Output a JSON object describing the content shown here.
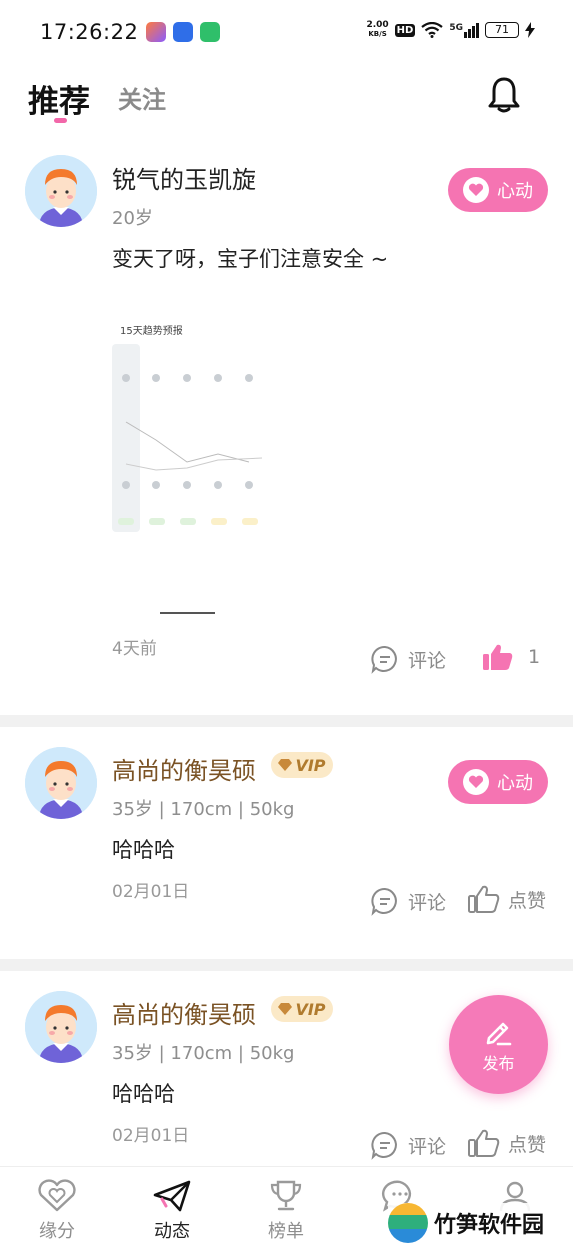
{
  "status_bar": {
    "time": "17:26:22",
    "net_speed_value": "2.00",
    "net_speed_unit": "KB/S",
    "hd": "HD",
    "network": "5G",
    "battery": "71"
  },
  "tabs": {
    "active": "推荐",
    "inactive": "关注"
  },
  "posts": [
    {
      "username": "锐气的玉凯旋",
      "meta": "20岁",
      "content": "变天了呀，宝子们注意安全 ~",
      "time": "4天前",
      "heart_label": "心动",
      "comment_label": "评论",
      "like_count": "1"
    },
    {
      "username": "高尚的衡昊硕",
      "vip": "VIP",
      "meta": "35岁 | 170cm | 50kg",
      "content": "哈哈哈",
      "time": "02月01日",
      "heart_label": "心动",
      "comment_label": "评论",
      "like_label": "点赞"
    },
    {
      "username": "高尚的衡昊硕",
      "vip": "VIP",
      "meta": "35岁 | 170cm | 50kg",
      "content": "哈哈哈",
      "time": "02月01日",
      "comment_label": "评论",
      "like_label": "点赞"
    }
  ],
  "post_image": {
    "title": "15天趋势预报"
  },
  "publish_label": "发布",
  "bottom_nav": [
    {
      "label": "缘分",
      "icon": "heart-outline-icon"
    },
    {
      "label": "动态",
      "icon": "paper-plane-icon"
    },
    {
      "label": "榜单",
      "icon": "trophy-icon"
    },
    {
      "label": "",
      "icon": "chat-icon"
    },
    {
      "label": "",
      "icon": "profile-icon"
    }
  ],
  "watermark": "竹笋软件园",
  "colors": {
    "accent_pink": "#f574b2",
    "vip_gold": "#b07b2e"
  }
}
